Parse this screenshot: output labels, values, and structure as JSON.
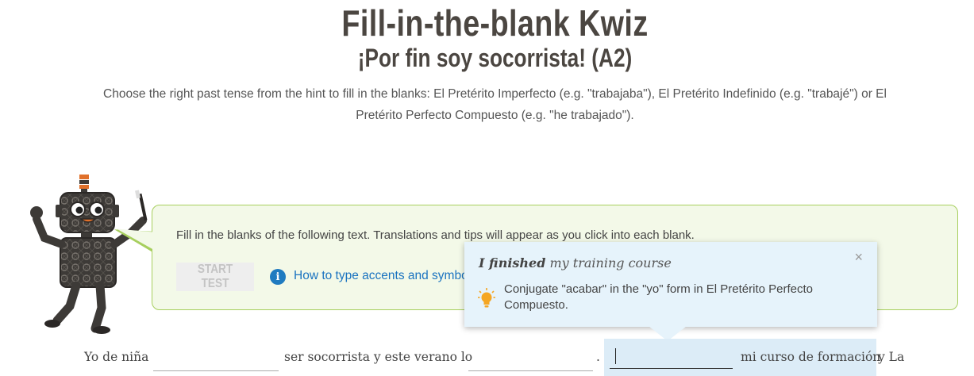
{
  "header": {
    "title": "Fill-in-the-blank Kwiz",
    "subtitle": "¡Por fin soy socorrista! (A2)",
    "instructions": "Choose the right past tense from the hint to fill in the blanks: El Pretérito Imperfecto (e.g. \"trabajaba\"), El Pretérito Indefinido (e.g. \"trabajé\") or El Pretérito Perfecto Compuesto (e.g. \"he trabajado\")."
  },
  "hint_box": {
    "text": "Fill in the blanks of the following text. Translations and tips will appear as you click into each blank.",
    "start_button": "START TEST",
    "accents_link": "How to type accents and symbols"
  },
  "tooltip": {
    "title_bold": "I finished",
    "title_rest": " my training course",
    "close": "×",
    "hint": "Conjugate \"acabar\" in the \"yo\" form in El Pretérito Perfecto Compuesto."
  },
  "exercise": {
    "seg1": "Yo de niña",
    "seg2": "ser socorrista  y este verano lo",
    "seg3": ".",
    "seg4": "mi curso de formación",
    "seg5": "y La",
    "blanks": [
      "",
      "",
      ""
    ]
  },
  "colors": {
    "accent_green": "#a7cf5e",
    "hint_bg": "#f3f9e8",
    "tooltip_bg": "#e6f3fb",
    "link_blue": "#1a73c0",
    "bulb": "#f5a623"
  }
}
